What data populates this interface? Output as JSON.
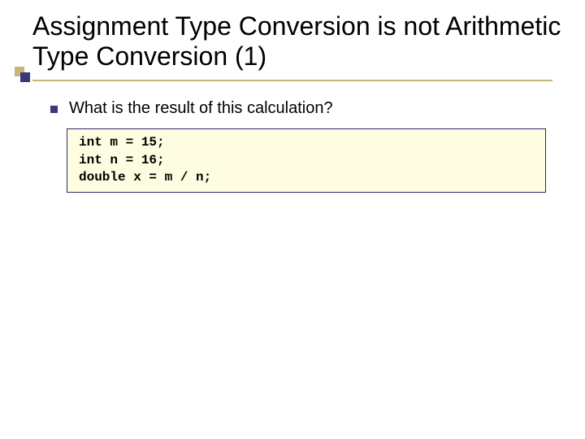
{
  "title": "Assignment Type Conversion is not Arithmetic Type Conversion (1)",
  "bullet": "What is the result of this calculation?",
  "code": "int m = 15;\nint n = 16;\ndouble x = m / n;"
}
